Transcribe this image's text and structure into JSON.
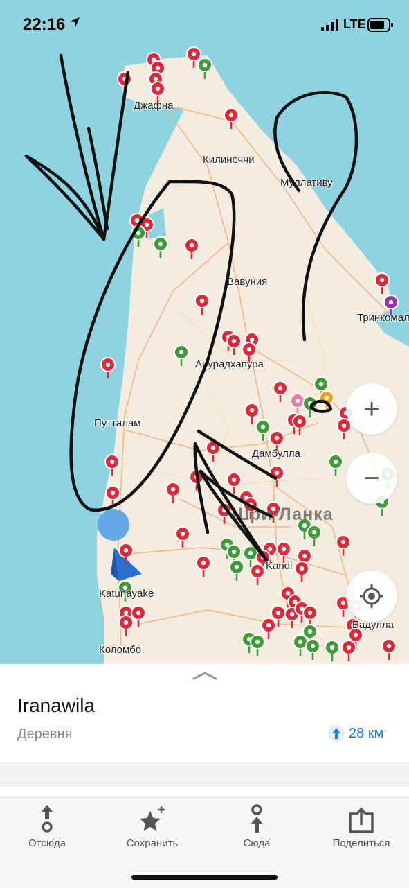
{
  "status_bar": {
    "time": "22:16",
    "network": "LTE"
  },
  "map": {
    "country_label": "Шри-Ланка",
    "city_labels": [
      "Джафна",
      "Килиноччи",
      "Муллативу",
      "Вавуния",
      "Тринкомали",
      "Анурадхапура",
      "Путталам",
      "Дамбулла",
      "Kandi",
      "Katunayake",
      "Бадулла",
      "Коломбо"
    ],
    "controls": {
      "zoom_in": "+",
      "zoom_out": "−"
    }
  },
  "place": {
    "name": "Iranawila",
    "type": "Деревня",
    "distance": "28 км"
  },
  "toolbar": {
    "from_here": "Отсюда",
    "save": "Сохранить",
    "to_here": "Сюда",
    "share": "Поделиться"
  },
  "colors": {
    "accent": "#1a7fd8",
    "water": "#8fd3e0",
    "land": "#f4ecdf",
    "pin_red": "#e0283a",
    "pin_green": "#3f9a3a"
  }
}
